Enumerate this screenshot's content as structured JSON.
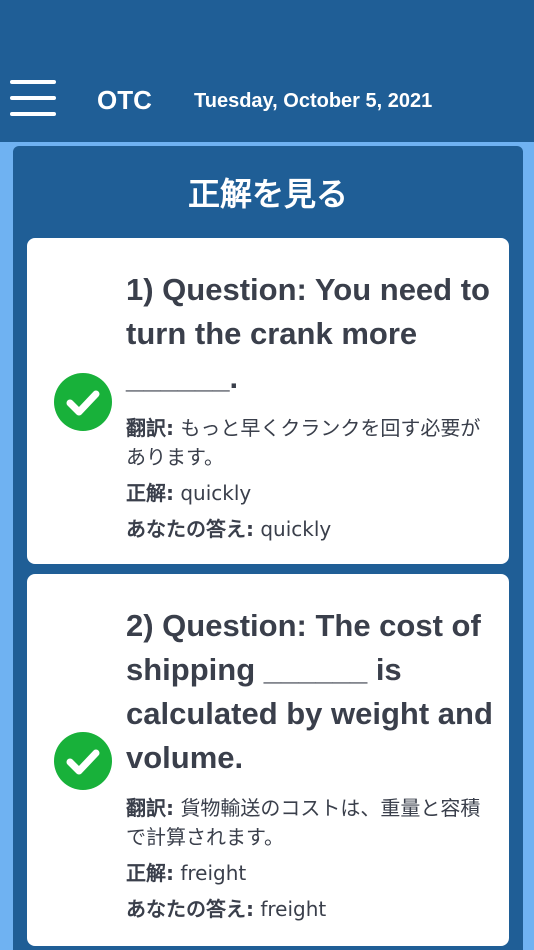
{
  "header": {
    "app_title": "OTC",
    "date": "Tuesday, October 5, 2021"
  },
  "page": {
    "title": "正解を見る"
  },
  "labels": {
    "translation": "翻訳:",
    "correct_answer": "正解:",
    "your_answer": "あなたの答え:"
  },
  "questions": [
    {
      "text": "1) Question: You need to turn the crank more ______.",
      "translation": "もっと早くクランクを回す必要があります。",
      "correct_answer": "quickly",
      "your_answer": "quickly",
      "status": "correct"
    },
    {
      "text": "2) Question: The cost of shipping ______ is calculated by weight and volume.",
      "translation": "貨物輸送のコストは、重量と容積で計算されます。",
      "correct_answer": "freight",
      "your_answer": "freight",
      "status": "correct"
    }
  ],
  "colors": {
    "header_bg": "#1f5e96",
    "page_bg": "#6fb2f2",
    "check_green": "#18b13a",
    "text": "#3a3f4b"
  },
  "icons": {
    "menu": "hamburger-menu-icon",
    "status": "check-circle-icon"
  }
}
